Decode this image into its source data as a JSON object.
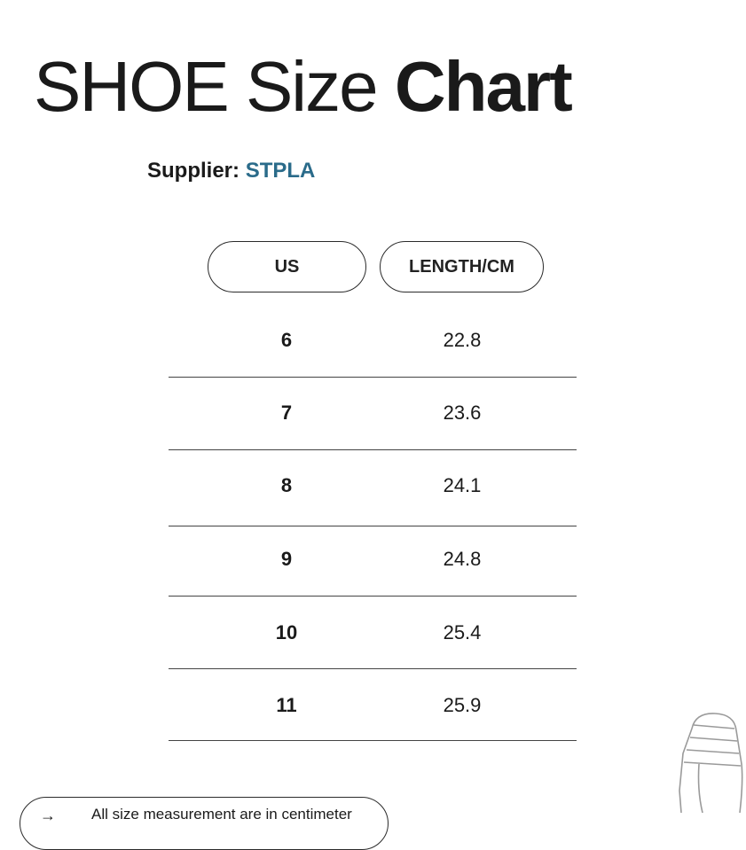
{
  "title": {
    "light": "SHOE Size",
    "bold": "Chart"
  },
  "supplier": {
    "label": "Supplier:",
    "value": "STPLA"
  },
  "table": {
    "headers": {
      "us": "US",
      "length": "LENGTH/CM"
    },
    "rows": [
      {
        "us": "6",
        "length": "22.8"
      },
      {
        "us": "7",
        "length": "23.6"
      },
      {
        "us": "8",
        "length": "24.1"
      },
      {
        "us": "9",
        "length": "24.8"
      },
      {
        "us": "10",
        "length": "25.4"
      },
      {
        "us": "11",
        "length": "25.9"
      }
    ]
  },
  "note": {
    "arrow": "→",
    "text": "All size measurement are in centimeter"
  },
  "icons": {
    "slipper": "slipper-outline-icon"
  },
  "colors": {
    "accent": "#2a6b8a",
    "text": "#1a1a1a",
    "line": "#444444"
  }
}
